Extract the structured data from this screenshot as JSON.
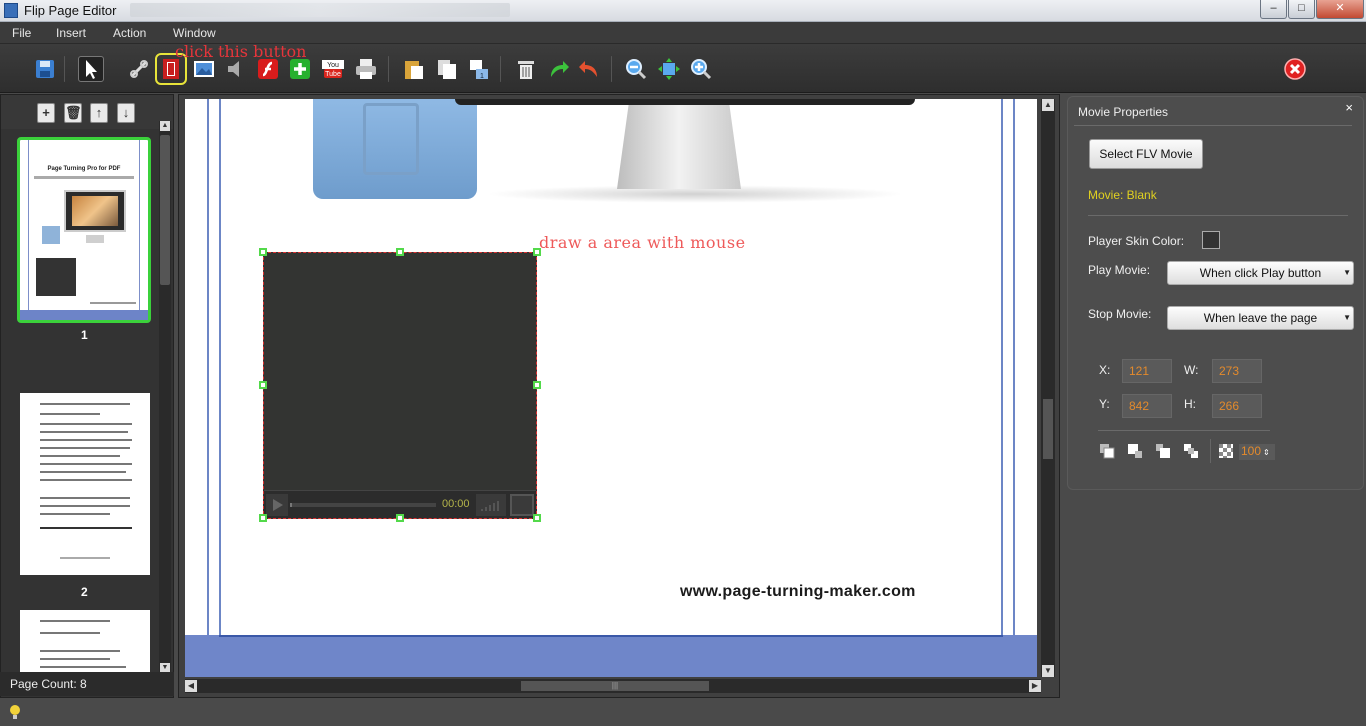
{
  "window": {
    "title": "Flip Page Editor",
    "min_label": "–",
    "max_label": "□",
    "close_label": "✕"
  },
  "menu": [
    "File",
    "Insert",
    "Action",
    "Window"
  ],
  "toolbar": {
    "icons": [
      "save-icon",
      "select-arrow-icon",
      "link-icon",
      "movie-icon",
      "image-icon",
      "sound-icon",
      "flash-icon",
      "add-plus-icon",
      "youtube-icon",
      "print-icon",
      "paste-icon",
      "copy-icon",
      "page-icon",
      "delete-icon",
      "redo-icon",
      "undo-icon",
      "zoom-out-icon",
      "fit-icon",
      "zoom-in-icon",
      "close-editor-icon"
    ],
    "hint": "click this button",
    "accent_highlight": "#e8e43a"
  },
  "left_panel": {
    "tools": [
      "+",
      "🗑",
      "↑",
      "↓"
    ],
    "thumb1_title": "Page Turning Pro for PDF",
    "page_numbers": [
      "1",
      "2"
    ],
    "page_count_label": "Page Count: 8"
  },
  "canvas": {
    "hint": "draw a area with mouse",
    "movie_time": "00:00",
    "url": "www.page-turning-maker.com"
  },
  "props": {
    "title": "Movie Properties",
    "close": "×",
    "select_button": "Select FLV Movie",
    "movie_name": "Movie: Blank",
    "skin_label": "Player Skin Color:",
    "skin_color": "#333333",
    "play_label": "Play Movie:",
    "play_value": "When click Play button",
    "stop_label": "Stop Movie:",
    "stop_value": "When leave the page",
    "x_label": "X:",
    "x_value": "121",
    "w_label": "W:",
    "w_value": "273",
    "y_label": "Y:",
    "y_value": "842",
    "h_label": "H:",
    "h_value": "266",
    "opacity": "100"
  }
}
